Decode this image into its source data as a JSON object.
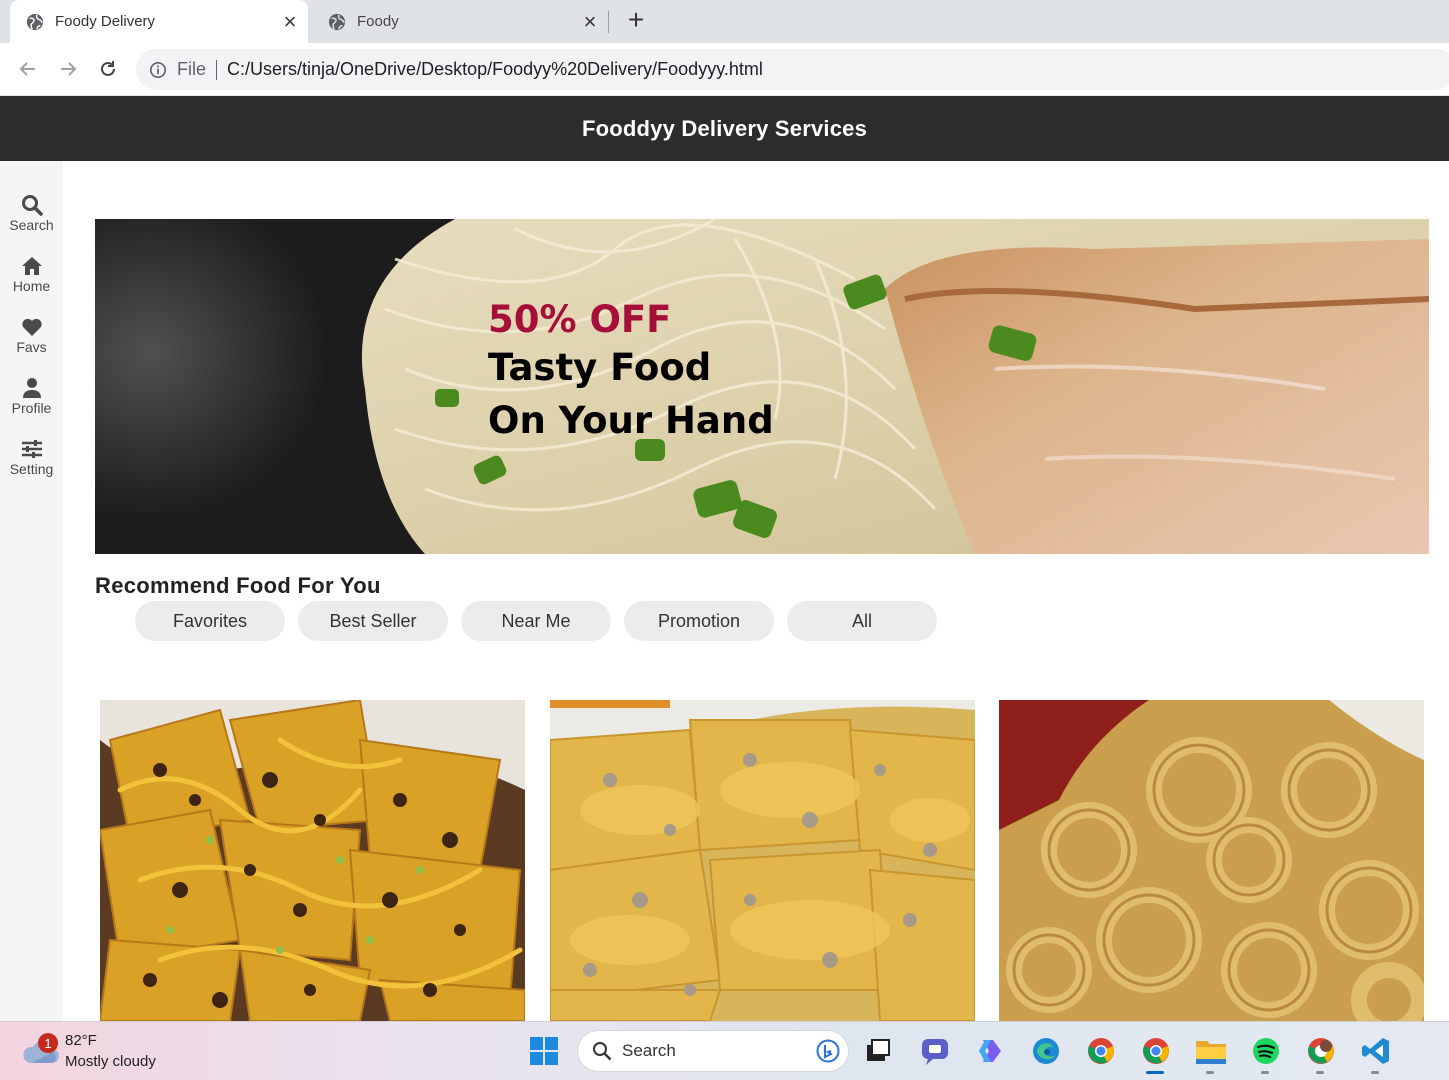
{
  "browser": {
    "tabs": [
      {
        "title": "Foody Delivery",
        "active": true
      },
      {
        "title": "Foody",
        "active": false
      }
    ],
    "address": {
      "scheme_label": "File",
      "url": "C:/Users/tinja/OneDrive/Desktop/Foodyy%20Delivery/Foodyyy.html"
    }
  },
  "header": {
    "title": "Fooddyy Delivery Services"
  },
  "sidebar": {
    "items": [
      {
        "label": "Search",
        "icon": "search-icon"
      },
      {
        "label": "Home",
        "icon": "home-icon"
      },
      {
        "label": "Favs",
        "icon": "heart-icon"
      },
      {
        "label": "Profile",
        "icon": "user-icon"
      },
      {
        "label": "Setting",
        "icon": "sliders-icon"
      }
    ]
  },
  "banner": {
    "line1": "50% OFF",
    "line2": "Tasty Food",
    "line3": "On Your Hand",
    "accent_color": "#a50f3a"
  },
  "recommend": {
    "title": "Recommend Food For You",
    "filters": [
      "Favorites",
      "Best Seller",
      "Near Me",
      "Promotion",
      "All"
    ]
  },
  "food_cards": [
    {
      "image": "beef-nachos-photo"
    },
    {
      "image": "cheese-nachos-photo"
    },
    {
      "image": "fried-calamari-photo"
    }
  ],
  "taskbar": {
    "weather": {
      "temp": "82°F",
      "condition": "Mostly cloudy",
      "badge": "1"
    },
    "search_placeholder": "Search"
  },
  "colors": {
    "header_bg": "#2b2c2e",
    "sidebar_bg": "#f5f5f5",
    "chip_bg": "#ececec",
    "promo_red": "#a50f3a"
  }
}
